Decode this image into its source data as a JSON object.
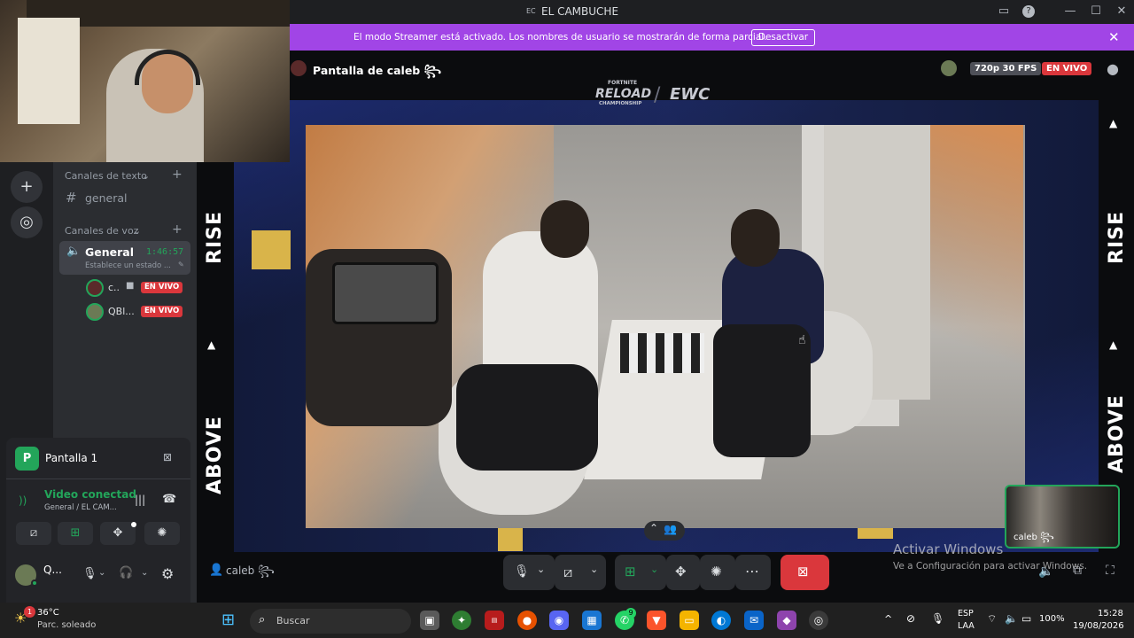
{
  "window": {
    "title": "EL CAMBUCHE",
    "icon_text": "EC"
  },
  "streamer_bar": {
    "message": "El modo Streamer está activado. Los nombres de usuario se mostrarán de forma parcial.",
    "button": "Desactivar"
  },
  "sidebar": {
    "text_category": "Canales de texto",
    "text_channel": "general",
    "voice_category": "Canales de voz",
    "voice_channel": {
      "name": "General",
      "timer": "1:46:57",
      "status": "Establece un estado ..."
    },
    "members": [
      {
        "name": "c..",
        "badge": "EN VIVO"
      },
      {
        "name": "QBl...",
        "badge": "EN VIVO"
      }
    ]
  },
  "panel": {
    "screen_name": "Pantalla 1",
    "connection_title": "Video conectad",
    "connection_sub": "General / EL CAM...",
    "user_name": "Q..."
  },
  "stream": {
    "title": "Pantalla de caleb ꧂",
    "quality": "720p 30 FPS",
    "live": "EN VIVO",
    "logo_left": "RELOAD",
    "logo_left_top": "FORTNITE",
    "logo_left_bottom": "CHAMPIONSHIP",
    "logo_right": "EWC",
    "side_text_top": "RISE",
    "side_text_bottom": "ABOVE",
    "footer_user": "caleb ꧂",
    "pip_name": "caleb ꧂",
    "watermark_title": "Activar Windows",
    "watermark_sub": "Ve a Configuración para activar Windows."
  },
  "taskbar": {
    "weather_temp": "36°C",
    "weather_desc": "Parc. soleado",
    "weather_badge": "1",
    "search_placeholder": "Buscar",
    "lang_top": "ESP",
    "lang_bottom": "LAA",
    "battery": "100%",
    "time": "15:28",
    "date": "19/08/2026",
    "whatsapp_badge": "9"
  },
  "colors": {
    "streamer": "#a145e6",
    "live": "#da373c",
    "green": "#23a55a",
    "end_call": "#da373c"
  }
}
